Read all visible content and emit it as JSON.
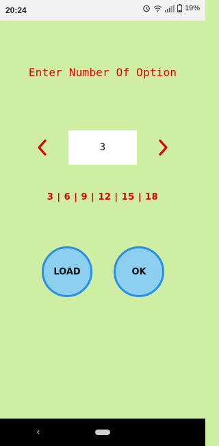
{
  "status_bar": {
    "time": "20:24",
    "battery": "19%",
    "icons": [
      "alarm-icon",
      "wifi-icon",
      "signal-icon",
      "battery-icon"
    ]
  },
  "title": "Enter Number Of Option",
  "selector": {
    "value": "3",
    "prev_icon": "chevron-left-icon",
    "next_icon": "chevron-right-icon"
  },
  "options_text": "3 | 6 | 9 | 12 | 15 | 18",
  "buttons": {
    "load": "LOAD",
    "ok": "OK"
  },
  "nav": {
    "back": "‹"
  },
  "colors": {
    "background": "#cdeea3",
    "accent": "#e00000",
    "button_fill": "#8ccfee",
    "button_border": "#2a8ee8"
  }
}
